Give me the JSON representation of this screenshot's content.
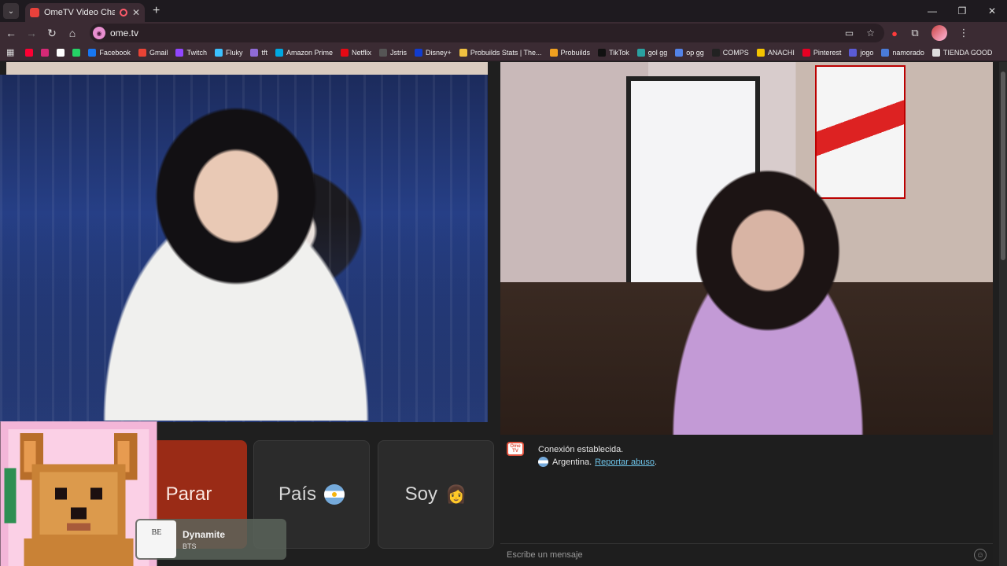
{
  "browser": {
    "tab_title": "OmeTV Video Chat — Ome",
    "tab_close": "✕",
    "new_tab": "+",
    "url": "ome.tv",
    "window": {
      "minimize": "—",
      "maximize": "❐",
      "close": "✕"
    }
  },
  "bookmarks": [
    {
      "label": "",
      "color": "#ff0033"
    },
    {
      "label": "",
      "color": "#d62976"
    },
    {
      "label": "",
      "color": "#ffffff"
    },
    {
      "label": "",
      "color": "#25d366"
    },
    {
      "label": "Facebook",
      "color": "#1877f2"
    },
    {
      "label": "Gmail",
      "color": "#ea4335"
    },
    {
      "label": "Twitch",
      "color": "#9146ff"
    },
    {
      "label": "Fluky",
      "color": "#3cc1ff"
    },
    {
      "label": "tft",
      "color": "#8f6bd6"
    },
    {
      "label": "Amazon Prime",
      "color": "#00a8e1"
    },
    {
      "label": "Netflix",
      "color": "#e50914"
    },
    {
      "label": "Jstris",
      "color": "#555555"
    },
    {
      "label": "Disney+",
      "color": "#113ccf"
    },
    {
      "label": "Probuilds Stats | The...",
      "color": "#f0c040"
    },
    {
      "label": "Probuilds",
      "color": "#f0a020"
    },
    {
      "label": "TikTok",
      "color": "#111111"
    },
    {
      "label": "gol gg",
      "color": "#2aa0a0"
    },
    {
      "label": "op gg",
      "color": "#5383e8"
    },
    {
      "label": "COMPS",
      "color": "#222222"
    },
    {
      "label": "ANACHI",
      "color": "#f5c400"
    },
    {
      "label": "Pinterest",
      "color": "#e60023"
    },
    {
      "label": "jogo",
      "color": "#5b5bd6"
    },
    {
      "label": "namorado",
      "color": "#4a7bd8"
    },
    {
      "label": "TIENDA GOOD",
      "color": "#dddddd"
    }
  ],
  "controls": {
    "stop_label": "Parar",
    "country_label": "País",
    "soy_label": "Soy",
    "soy_emoji": "👩"
  },
  "music": {
    "cover_text": "BE",
    "song": "Dynamite",
    "artist": "BTS"
  },
  "chat": {
    "logo_text": "Ome TV",
    "status": "Conexión establecida.",
    "country": "Argentina.",
    "report": "Reportar abuso",
    "report_suffix": ".",
    "placeholder": "Escribe un mensaje"
  }
}
